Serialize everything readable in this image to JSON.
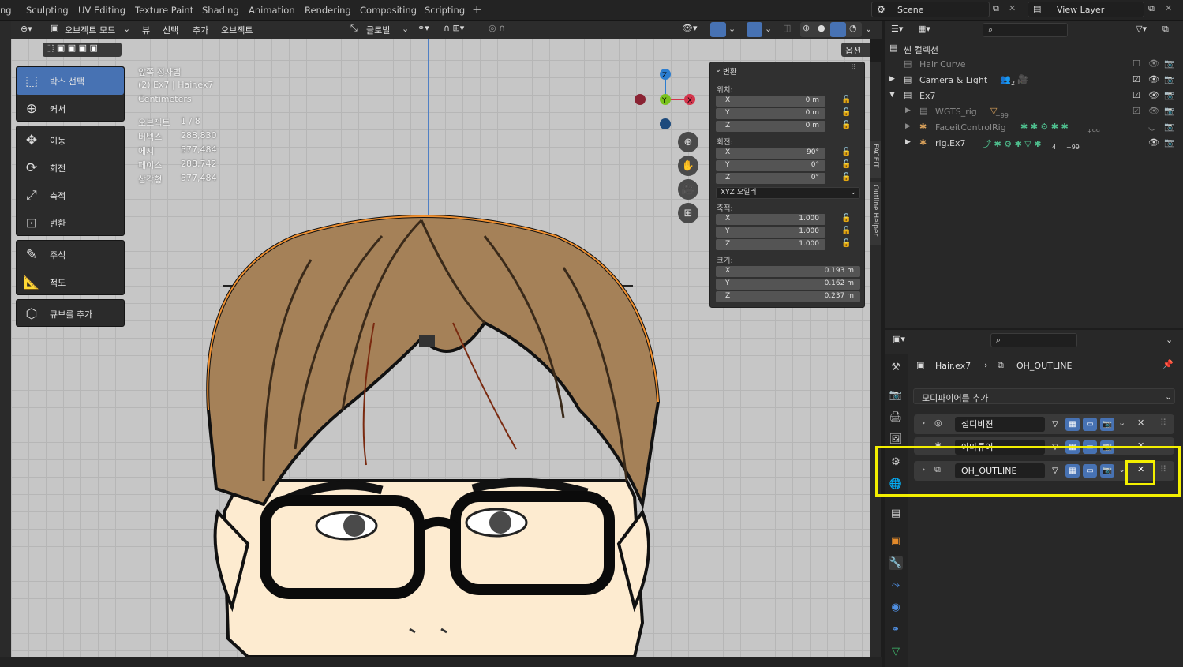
{
  "workspaces": {
    "tabs": [
      "ng",
      "Sculpting",
      "UV Editing",
      "Texture Paint",
      "Shading",
      "Animation",
      "Rendering",
      "Compositing",
      "Scripting"
    ],
    "add": "+"
  },
  "scene": {
    "name": "Scene",
    "view_layer": "View Layer"
  },
  "viewport_header": {
    "mode": "오브젝트 모드",
    "menus": [
      "뷰",
      "선택",
      "추가",
      "오브젝트"
    ],
    "orientation": "글로벌",
    "options": "옵션"
  },
  "tools": [
    {
      "label": "박스 선택",
      "icon": "box-select-icon",
      "active": true
    },
    {
      "label": "커서",
      "icon": "cursor-icon"
    },
    {
      "label": "이동",
      "icon": "move-icon"
    },
    {
      "label": "회전",
      "icon": "rotate-icon"
    },
    {
      "label": "축적",
      "icon": "scale-icon"
    },
    {
      "label": "변환",
      "icon": "transform-icon"
    },
    {
      "label": "주석",
      "icon": "annotate-icon"
    },
    {
      "label": "척도",
      "icon": "measure-icon"
    },
    {
      "label": "큐브를 추가",
      "icon": "add-cube-icon"
    }
  ],
  "overlay": {
    "view": "앞쪽 정사법",
    "object": "(2) Ex7 | Hair.ex7",
    "units": "Centimeters",
    "stats": [
      {
        "label": "오브젝트",
        "value": "1 / 8"
      },
      {
        "label": "버텍스",
        "value": "288,830"
      },
      {
        "label": "에지",
        "value": "577,484"
      },
      {
        "label": "페이스",
        "value": "288,742"
      },
      {
        "label": "삼각형",
        "value": "577,484"
      }
    ]
  },
  "transform_panel": {
    "title": "변환",
    "location_label": "위치:",
    "location": [
      {
        "axis": "X",
        "value": "0 m"
      },
      {
        "axis": "Y",
        "value": "0 m"
      },
      {
        "axis": "Z",
        "value": "0 m"
      }
    ],
    "rotation_label": "회전:",
    "rotation": [
      {
        "axis": "X",
        "value": "90°"
      },
      {
        "axis": "Y",
        "value": "0°"
      },
      {
        "axis": "Z",
        "value": "0°"
      }
    ],
    "rotation_mode": "XYZ 오일러",
    "scale_label": "축적:",
    "scale": [
      {
        "axis": "X",
        "value": "1.000"
      },
      {
        "axis": "Y",
        "value": "1.000"
      },
      {
        "axis": "Z",
        "value": "1.000"
      }
    ],
    "dimensions_label": "크기:",
    "dimensions": [
      {
        "axis": "X",
        "value": "0.193 m"
      },
      {
        "axis": "Y",
        "value": "0.162 m"
      },
      {
        "axis": "Z",
        "value": "0.237 m"
      }
    ]
  },
  "side_tabs": [
    "FACEIT",
    "Outline Helper"
  ],
  "gizmo": {
    "x": "X",
    "y": "Y",
    "z": "Z"
  },
  "outliner": {
    "root": "씬 컬렉션",
    "rows": [
      {
        "name": "Hair Curve",
        "dim": true
      },
      {
        "name": "Camera & Light",
        "badge": "2"
      },
      {
        "name": "Ex7"
      },
      {
        "name": "WGTS_rig",
        "dim": true,
        "badge": "+99"
      },
      {
        "name": "FaceitControlRig",
        "dim": true,
        "badge": "+99"
      },
      {
        "name": "rig.Ex7",
        "badge": "+99",
        "badge2": "4"
      }
    ]
  },
  "properties": {
    "breadcrumb_object": "Hair.ex7",
    "breadcrumb_modifier": "OH_OUTLINE",
    "add_modifier": "모디파이어를 추가",
    "modifiers": [
      {
        "name": "섭디비젼"
      },
      {
        "name": "아마튜어"
      },
      {
        "name": "OH_OUTLINE"
      }
    ],
    "highlight_color": "#f3ef00"
  },
  "colors": {
    "accent": "#4772b3",
    "x_axis": "#d3354c",
    "y_axis": "#7ac21c",
    "z_axis": "#2c7dcf",
    "outline": "#f09030"
  }
}
